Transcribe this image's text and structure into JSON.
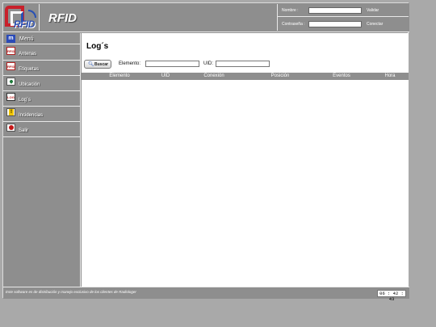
{
  "header": {
    "logo_text": "RFID",
    "brand": "RFID"
  },
  "login": {
    "username_label": "Nombre :",
    "password_label": "Contraseña :",
    "validate_label": "Validar",
    "connect_label": "Conectar",
    "username_value": "",
    "password_value": ""
  },
  "sidebar": {
    "menu_icon_text": "m",
    "title": "Menú",
    "items": [
      {
        "label": "Antenas",
        "icon": "antenna-icon",
        "icon_text": "RFID"
      },
      {
        "label": "Etiquetas",
        "icon": "tag-icon",
        "icon_text": "RFID"
      },
      {
        "label": "Ubicación",
        "icon": "location-icon",
        "icon_text": ""
      },
      {
        "label": "Log´s",
        "icon": "log-icon",
        "icon_text": "LOG"
      },
      {
        "label": "Incidencias",
        "icon": "warning-icon",
        "icon_text": ""
      },
      {
        "label": "Salir",
        "icon": "exit-icon",
        "icon_text": ""
      }
    ]
  },
  "main": {
    "title": "Log´s",
    "search_button": "Buscar",
    "element_label": "Elemento:",
    "element_value": "",
    "uid_label": "UID:",
    "uid_value": "",
    "columns": [
      "Elemento",
      "UID",
      "Conexión",
      "Posición",
      "Eventos",
      "Hora"
    ],
    "rows": []
  },
  "footer": {
    "text": "Este software es de distribución y manejo exclusivo de los clientes de Radiologer",
    "clock": "06 : 42 : 43"
  },
  "colors": {
    "chrome": "#8e8e8e",
    "background": "#a9a9a9",
    "content": "#ffffff",
    "accent_red": "#c8202b",
    "accent_blue": "#2d4fb0"
  }
}
